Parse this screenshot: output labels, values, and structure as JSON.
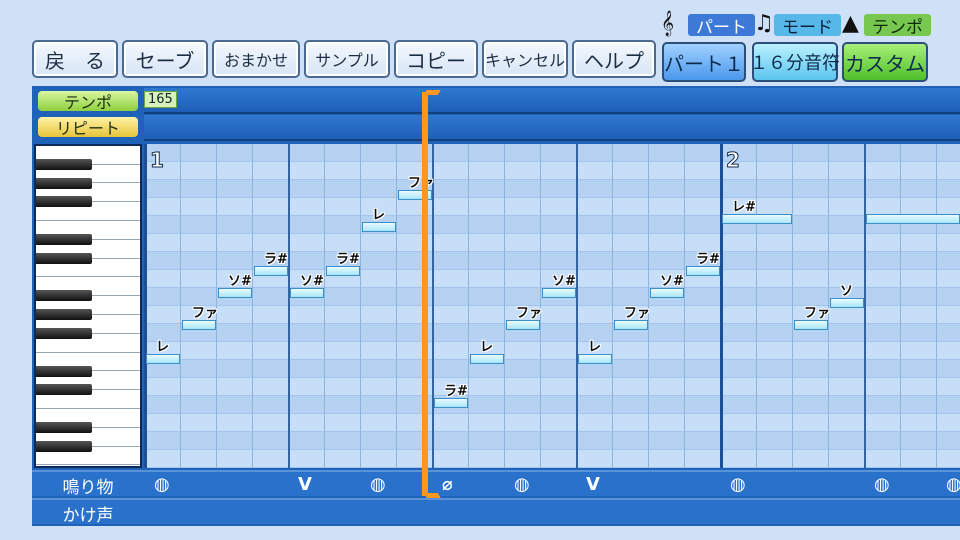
{
  "toolbar": {
    "back": "戻　る",
    "save": "セーブ",
    "omakase": "おまかせ",
    "sample": "サンプル",
    "copy": "コピー",
    "cancel": "キャンセル",
    "help": "ヘルプ"
  },
  "mode_header": {
    "part": "パート",
    "mode": "モード",
    "tempo": "テンポ"
  },
  "mode_buttons": {
    "part": "パート１",
    "mode": "１６分音符",
    "tempo": "カスタム"
  },
  "tracks": {
    "tempo": "テンポ",
    "tempo_value": "165",
    "repeat": "リピート",
    "percussion": "鳴り物",
    "calls": "かけ声"
  },
  "measures": [
    "1",
    "2"
  ],
  "notes": [
    "レ",
    "ファ",
    "ソ#",
    "ラ#",
    "ソ#",
    "ラ#",
    "レ",
    "ファ",
    "ラ#",
    "レ",
    "ファ",
    "ソ#",
    "レ",
    "ファ",
    "ソ#",
    "ラ#",
    "レ#",
    "ファ",
    "ソ"
  ],
  "percussion_hits": [
    "drum",
    "stick",
    "drum",
    "shaker",
    "drum",
    "stick",
    "drum",
    "drum",
    "drum"
  ],
  "colors": {
    "editor_bg": "#1f62b9",
    "grid_bg": "#bcd7f5",
    "cursor": "#ff9620",
    "note": "#a6e6ff"
  }
}
